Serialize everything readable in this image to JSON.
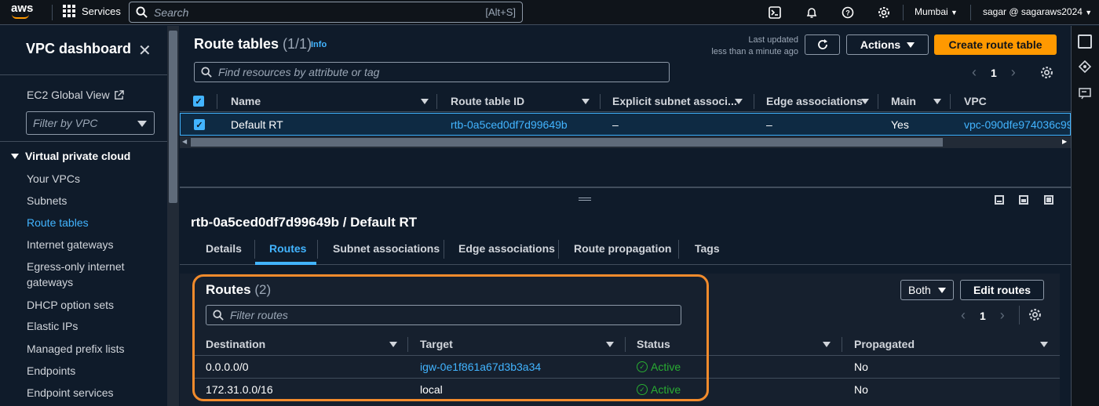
{
  "topnav": {
    "logo": "aws",
    "services_label": "Services",
    "search_placeholder": "Search",
    "search_shortcut": "[Alt+S]",
    "region": "Mumbai",
    "account": "sagar @ sagaraws2024"
  },
  "sidebar": {
    "title": "VPC dashboard",
    "ec2_global_view": "EC2 Global View",
    "filter_placeholder": "Filter by VPC",
    "section": "Virtual private cloud",
    "items": [
      {
        "label": "Your VPCs"
      },
      {
        "label": "Subnets"
      },
      {
        "label": "Route tables",
        "active": true
      },
      {
        "label": "Internet gateways"
      },
      {
        "label": "Egress-only internet"
      },
      {
        "label": "gateways"
      },
      {
        "label": "DHCP option sets"
      },
      {
        "label": "Elastic IPs"
      },
      {
        "label": "Managed prefix lists"
      },
      {
        "label": "Endpoints"
      },
      {
        "label": "Endpoint services"
      }
    ]
  },
  "route_tables": {
    "title": "Route tables",
    "count": "(1/1)",
    "info": "Info",
    "last_updated_label": "Last updated",
    "last_updated_value": "less than a minute ago",
    "actions_label": "Actions",
    "create_label": "Create route table",
    "search_placeholder": "Find resources by attribute or tag",
    "page": "1",
    "columns": [
      "Name",
      "Route table ID",
      "Explicit subnet associ...",
      "Edge associations",
      "Main",
      "VPC"
    ],
    "row": {
      "name": "Default RT",
      "id": "rtb-0a5ced0df7d99649b",
      "explicit": "–",
      "edge": "–",
      "main": "Yes",
      "vpc": "vpc-090dfe974036c99"
    }
  },
  "detail": {
    "title": "rtb-0a5ced0df7d99649b / Default RT",
    "tabs": [
      "Details",
      "Routes",
      "Subnet associations",
      "Edge associations",
      "Route propagation",
      "Tags"
    ],
    "active_tab": "Routes",
    "routes": {
      "title": "Routes",
      "count": "(2)",
      "filter_placeholder": "Filter routes",
      "both_label": "Both",
      "edit_label": "Edit routes",
      "page": "1",
      "columns": [
        "Destination",
        "Target",
        "Status",
        "Propagated"
      ],
      "rows": [
        {
          "destination": "0.0.0.0/0",
          "target": "igw-0e1f861a67d3b3a34",
          "status": "Active",
          "propagated": "No"
        },
        {
          "destination": "172.31.0.0/16",
          "target": "local",
          "status": "Active",
          "propagated": "No"
        }
      ]
    }
  },
  "colors": {
    "accent": "#42b4ff",
    "primary_button": "#ff9900",
    "highlight": "#f28b2c",
    "status_ok": "#29ad32"
  }
}
